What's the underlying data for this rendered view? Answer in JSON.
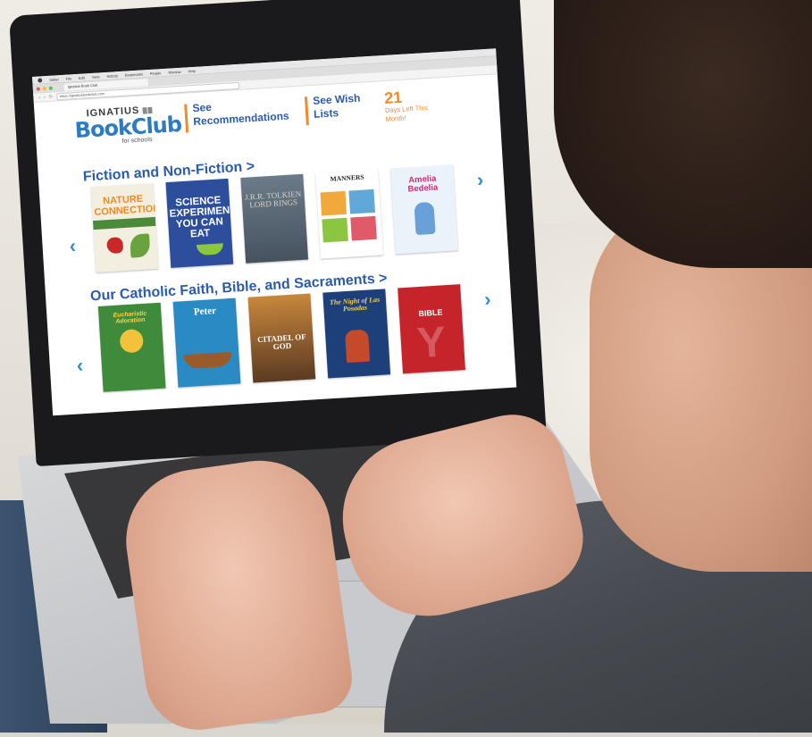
{
  "browser": {
    "menu": [
      "Safari",
      "File",
      "Edit",
      "View",
      "History",
      "Bookmarks",
      "People",
      "Window",
      "Help"
    ],
    "tab_title": "Ignatius Book Club",
    "url": "https://ignatiusbookclub.com"
  },
  "logo": {
    "top": "IGNATIUS",
    "main": "BookClub",
    "sub": "for schools"
  },
  "nav": {
    "recommendations": "See Recommendations",
    "wishlists": "See Wish Lists"
  },
  "countdown": {
    "days": "21",
    "label": "Days Left This Month!"
  },
  "sections": [
    {
      "title": "Fiction and Non-Fiction >",
      "books": [
        {
          "title": "NATURE CONNECTION"
        },
        {
          "title": "SCIENCE EXPERIMENTS YOU CAN EAT"
        },
        {
          "title": "J.R.R. TOLKIEN LORD RINGS"
        },
        {
          "title": "MANNERS"
        },
        {
          "title": "Amelia Bedelia"
        }
      ]
    },
    {
      "title": "Our Catholic Faith, Bible, and Sacraments >",
      "books": [
        {
          "title": "Eucharistic Adoration"
        },
        {
          "title": "Peter"
        },
        {
          "title": "CITADEL OF GOD"
        },
        {
          "title": "The Night of Las Posadas"
        },
        {
          "title": "BIBLE"
        }
      ]
    }
  ],
  "icons": {
    "prev": "‹",
    "next": "›"
  },
  "colors": {
    "brand_blue": "#2b5ca8",
    "accent_orange": "#ef8b2c",
    "arrow_blue": "#2e8ed0"
  }
}
